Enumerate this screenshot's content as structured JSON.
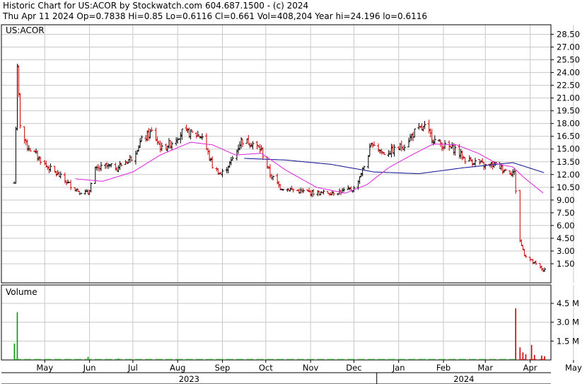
{
  "header": {
    "line1": "Historic Chart for US:ACOR by Stockwatch.com 604.687.1500 - (c) 2024",
    "line2": "Thu Apr 11 2024   Op=0.7838   Hi=0.85   Lo=0.6116   Cl=0.661   Vol=408,204   Year hi=24.196   lo=0.6116"
  },
  "chart_data": {
    "type": "ohlc",
    "symbol_label": "US:ACOR",
    "price_axis": {
      "ticks": [
        "28.50",
        "27.00",
        "25.50",
        "24.00",
        "22.50",
        "21.00",
        "19.50",
        "18.00",
        "16.50",
        "15.00",
        "13.50",
        "12.00",
        "10.50",
        "9.00",
        "7.50",
        "6.00",
        "4.50",
        "3.00",
        "1.50"
      ],
      "range": [
        0,
        29.5
      ]
    },
    "volume_axis": {
      "label": "Volume",
      "ticks": [
        "4.5 M",
        "3.0 M",
        "1.5 M"
      ],
      "range": [
        0,
        5.5
      ]
    },
    "x_axis": {
      "months": [
        "May",
        "Jun",
        "Jul",
        "Aug",
        "Sep",
        "Oct",
        "Nov",
        "Dec",
        "Jan",
        "Feb",
        "Mar",
        "Apr",
        "May"
      ],
      "years": [
        "2023",
        "2024"
      ]
    },
    "price_anchors": [
      [
        "2023-04-10",
        11
      ],
      [
        "2023-04-12",
        24.2
      ],
      [
        "2023-04-14",
        18
      ],
      [
        "2023-04-18",
        15.5
      ],
      [
        "2023-04-24",
        14.5
      ],
      [
        "2023-05-02",
        13
      ],
      [
        "2023-05-10",
        12
      ],
      [
        "2023-05-17",
        11
      ],
      [
        "2023-05-25",
        10
      ],
      [
        "2023-05-31",
        9.8
      ],
      [
        "2023-06-05",
        12.5
      ],
      [
        "2023-06-12",
        13
      ],
      [
        "2023-06-20",
        12.8
      ],
      [
        "2023-06-30",
        14
      ],
      [
        "2023-07-07",
        16
      ],
      [
        "2023-07-14",
        17
      ],
      [
        "2023-07-21",
        15
      ],
      [
        "2023-07-28",
        15.8
      ],
      [
        "2023-08-04",
        17
      ],
      [
        "2023-08-11",
        16.8
      ],
      [
        "2023-08-18",
        16.5
      ],
      [
        "2023-08-25",
        13
      ],
      [
        "2023-08-31",
        12
      ],
      [
        "2023-09-07",
        13.5
      ],
      [
        "2023-09-14",
        16
      ],
      [
        "2023-09-21",
        15.8
      ],
      [
        "2023-09-28",
        14.8
      ],
      [
        "2023-10-04",
        12
      ],
      [
        "2023-10-11",
        10.5
      ],
      [
        "2023-10-25",
        10
      ],
      [
        "2023-11-08",
        9.8
      ],
      [
        "2023-11-22",
        10
      ],
      [
        "2023-12-01",
        10.3
      ],
      [
        "2023-12-07",
        12.5
      ],
      [
        "2023-12-14",
        15.8
      ],
      [
        "2023-12-21",
        14.5
      ],
      [
        "2023-12-28",
        14.8
      ],
      [
        "2024-01-05",
        15.5
      ],
      [
        "2024-01-12",
        17
      ],
      [
        "2024-01-19",
        17.5
      ],
      [
        "2024-01-26",
        16
      ],
      [
        "2024-02-02",
        15.3
      ],
      [
        "2024-02-09",
        15
      ],
      [
        "2024-02-16",
        13.8
      ],
      [
        "2024-02-23",
        13.5
      ],
      [
        "2024-03-01",
        13
      ],
      [
        "2024-03-08",
        13.2
      ],
      [
        "2024-03-15",
        12.5
      ],
      [
        "2024-03-21",
        12.2
      ],
      [
        "2024-03-25",
        4.2
      ],
      [
        "2024-03-28",
        2.6
      ],
      [
        "2024-04-04",
        1.5
      ],
      [
        "2024-04-09",
        0.9
      ],
      [
        "2024-04-11",
        0.7
      ]
    ],
    "ma_short_anchors": [
      [
        "2023-05-22",
        11.5
      ],
      [
        "2023-06-10",
        11.2
      ],
      [
        "2023-07-01",
        12.3
      ],
      [
        "2023-07-20",
        14.3
      ],
      [
        "2023-08-10",
        15.8
      ],
      [
        "2023-08-25",
        15.5
      ],
      [
        "2023-09-10",
        14.3
      ],
      [
        "2023-09-28",
        14.5
      ],
      [
        "2023-10-15",
        12.5
      ],
      [
        "2023-11-05",
        10.5
      ],
      [
        "2023-11-25",
        9.8
      ],
      [
        "2023-12-10",
        10.8
      ],
      [
        "2023-12-25",
        12.8
      ],
      [
        "2024-01-10",
        14.3
      ],
      [
        "2024-01-25",
        15.6
      ],
      [
        "2024-02-10",
        15.5
      ],
      [
        "2024-02-25",
        14.5
      ],
      [
        "2024-03-10",
        13.2
      ],
      [
        "2024-03-20",
        12.9
      ],
      [
        "2024-03-28",
        11.6
      ],
      [
        "2024-04-11",
        9.7
      ]
    ],
    "ma_long_anchors": [
      [
        "2023-09-16",
        13.9
      ],
      [
        "2023-10-15",
        13.7
      ],
      [
        "2023-11-15",
        13.2
      ],
      [
        "2023-12-15",
        12.3
      ],
      [
        "2024-01-15",
        12.1
      ],
      [
        "2024-02-15",
        12.8
      ],
      [
        "2024-03-20",
        13.4
      ],
      [
        "2024-04-11",
        12.2
      ]
    ],
    "volume_bars_M": [
      [
        "2023-04-10",
        1.3
      ],
      [
        "2023-04-12",
        3.8
      ],
      [
        "2023-05-31",
        0.25
      ],
      [
        "2023-06-21",
        0.12
      ],
      [
        "2023-03-24",
        0.1
      ],
      [
        "2024-03-22",
        4.1
      ],
      [
        "2024-03-25",
        1.0
      ],
      [
        "2024-03-27",
        0.6
      ],
      [
        "2024-03-29",
        0.45
      ],
      [
        "2024-04-02",
        1.2
      ],
      [
        "2024-04-04",
        0.4
      ],
      [
        "2024-04-09",
        0.35
      ],
      [
        "2024-04-11",
        0.3
      ]
    ],
    "colors": {
      "bar_up": "#000000",
      "bar_down": "#cc0000",
      "ma_short": "#dd33dd",
      "ma_long": "#22229a",
      "vol_old": "#009900",
      "vol_new": "#cc0000",
      "grid": "#c8c8c8"
    }
  }
}
